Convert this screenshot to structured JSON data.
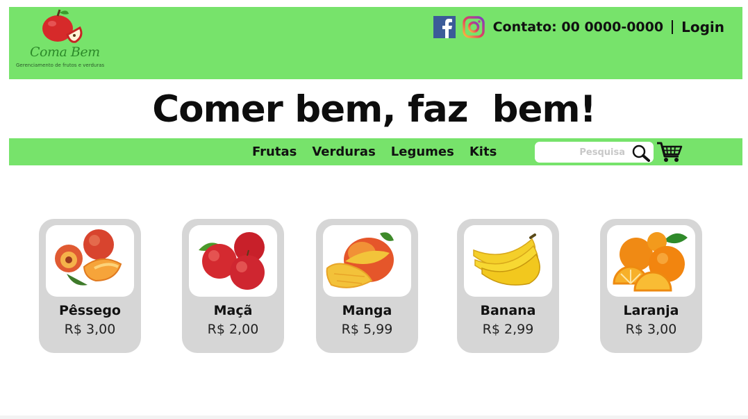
{
  "brand": {
    "name": "Coma Bem",
    "tagline": "Gerenciamento de frutos e verduras"
  },
  "header": {
    "contact": "Contato: 00 0000-0000",
    "login": "Login",
    "icons": [
      "facebook-icon",
      "instagram-icon"
    ]
  },
  "hero": {
    "title": "Comer bem, faz  bem!"
  },
  "nav": {
    "items": [
      "Frutas",
      "Verduras",
      "Legumes",
      "Kits"
    ],
    "search_placeholder": "Pesquisa"
  },
  "products": [
    {
      "name": "Pêssego",
      "price": "R$ 3,00",
      "icon": "peach-image"
    },
    {
      "name": "Maçã",
      "price": "R$ 2,00",
      "icon": "apple-image"
    },
    {
      "name": "Manga",
      "price": "R$ 5,99",
      "icon": "mango-image"
    },
    {
      "name": "Banana",
      "price": "R$ 2,99",
      "icon": "banana-image"
    },
    {
      "name": "Laranja",
      "price": "R$ 3,00",
      "icon": "orange-image"
    }
  ],
  "colors": {
    "accent_green": "#77e36b",
    "card_gray": "#d6d6d6",
    "logo_text": "#2d8a2a"
  }
}
